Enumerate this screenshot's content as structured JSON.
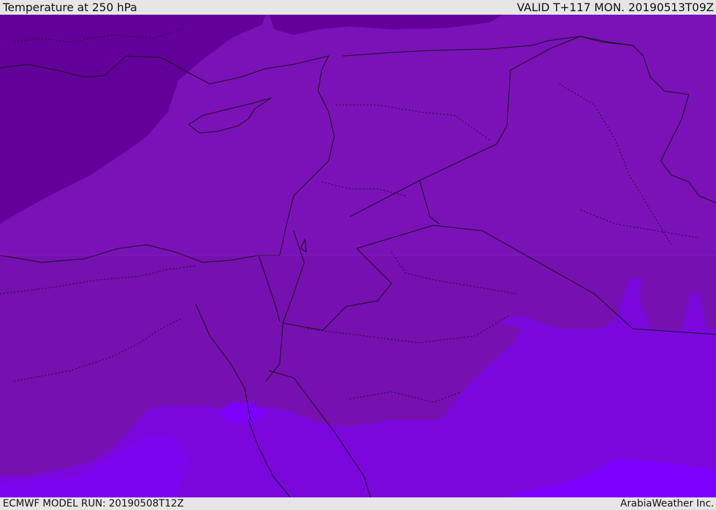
{
  "header": {
    "title": "Temperature at 250 hPa",
    "valid_time": "VALID T+117 MON. 20190513T09Z"
  },
  "footer": {
    "model_run": "ECMWF MODEL RUN: 20190508T12Z",
    "credit": "ArabiaWeather Inc."
  },
  "map": {
    "field_colors": {
      "coldest": "#63009a",
      "cold": "#760eb4",
      "mid": "#7a12b8",
      "warm": "#7a08dc",
      "warmest": "#7d00ff"
    },
    "line_color": "#111111"
  }
}
